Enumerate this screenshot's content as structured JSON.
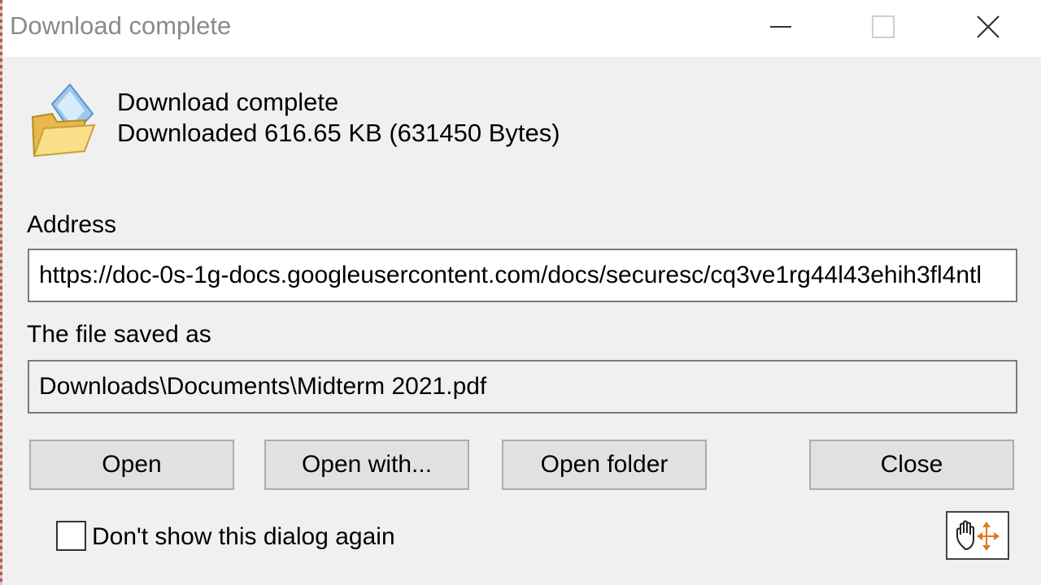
{
  "window": {
    "title": "Download complete",
    "controls": {
      "minimize": "minimize-icon",
      "maximize": "maximize-icon",
      "close": "close-icon"
    }
  },
  "header": {
    "icon": "folder-open-icon",
    "status": "Download complete",
    "size_text": "Downloaded 616.65  KB (631450 Bytes)"
  },
  "address": {
    "label": "Address",
    "value": "https://doc-0s-1g-docs.googleusercontent.com/docs/securesc/cq3ve1rg44l43ehih3fl4ntl"
  },
  "saved_as": {
    "label": "The file saved as",
    "value": "Downloads\\Documents\\Midterm 2021.pdf"
  },
  "buttons": {
    "open": "Open",
    "open_with": "Open with...",
    "open_folder": "Open folder",
    "close": "Close"
  },
  "options": {
    "dont_show_label": "Don't show this dialog again",
    "dont_show_checked": false
  },
  "drag_icon": "hand-drag-icon"
}
